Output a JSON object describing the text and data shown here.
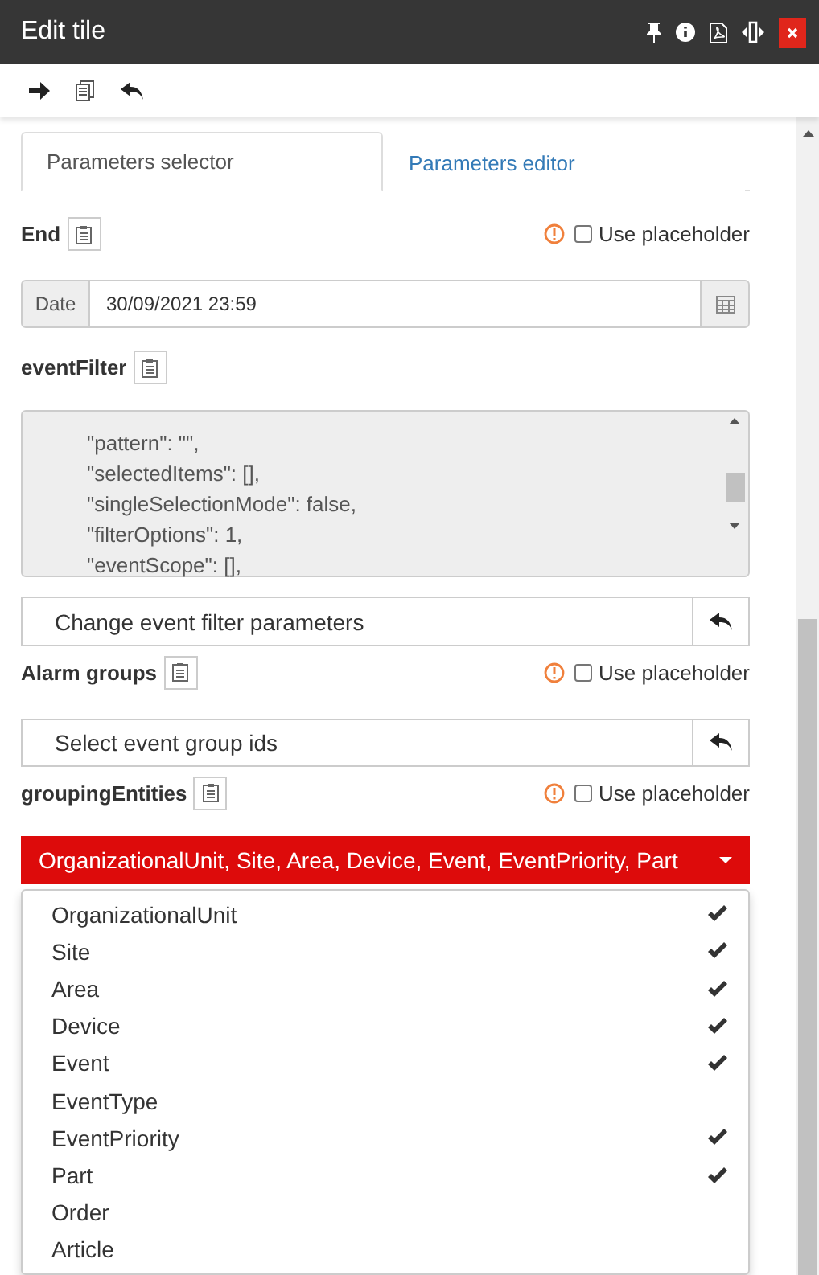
{
  "window": {
    "title": "Edit tile"
  },
  "tabs": [
    {
      "label": "Parameters selector",
      "selected": true
    },
    {
      "label": "Parameters editor",
      "selected": false
    }
  ],
  "params": [
    {
      "kind": "date",
      "label": "End",
      "use_placeholder": {
        "label": "Use placeholder",
        "checked": false
      },
      "addon": "Date",
      "value": "30/09/2021 23:59"
    },
    {
      "kind": "json",
      "label": "eventFilter",
      "lines": [
        "\"pattern\": \"\",",
        "\"selectedItems\": [],",
        "\"singleSelectionMode\": false,",
        "\"filterOptions\": 1,",
        "\"eventScope\": [],"
      ],
      "action": "Change event filter parameters"
    },
    {
      "kind": "action",
      "label": "Alarm groups",
      "use_placeholder": {
        "label": "Use placeholder",
        "checked": false
      },
      "action": "Select event group ids"
    },
    {
      "kind": "multiselect",
      "label": "groupingEntities",
      "use_placeholder": {
        "label": "Use placeholder",
        "checked": false
      },
      "value": "OrganizationalUnit, Site, Area, Device, Event, EventPriority, Part",
      "expanded": true,
      "options": [
        {
          "label": "OrganizationalUnit",
          "selected": true
        },
        {
          "label": "Site",
          "selected": true
        },
        {
          "label": "Area",
          "selected": true
        },
        {
          "label": "Device",
          "selected": true
        },
        {
          "label": "Event",
          "selected": true
        },
        {
          "label": "EventType",
          "selected": false
        },
        {
          "label": "EventPriority",
          "selected": true
        },
        {
          "label": "Part",
          "selected": true
        },
        {
          "label": "Order",
          "selected": false
        },
        {
          "label": "Article",
          "selected": false
        }
      ]
    }
  ]
}
